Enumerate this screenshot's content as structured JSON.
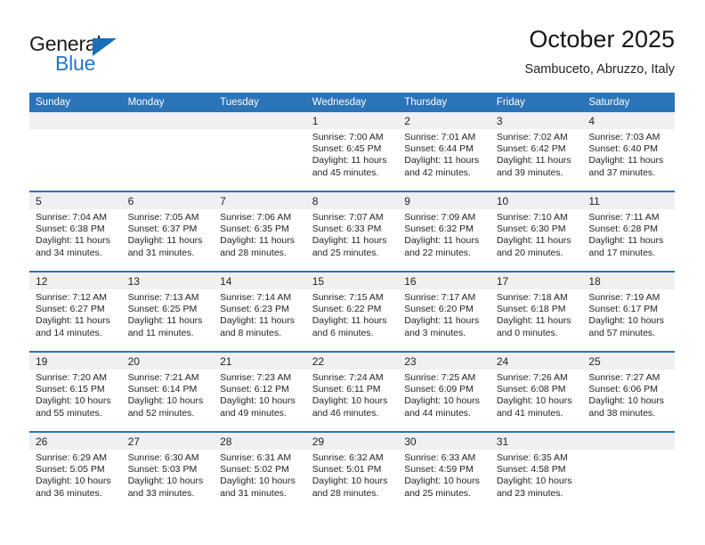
{
  "logo": {
    "word_top": "General",
    "word_bottom": "Blue",
    "triangle_color": "#1a6fb5",
    "blue_color": "#2277c8"
  },
  "header": {
    "title": "October 2025",
    "subtitle": "Sambuceto, Abruzzo, Italy"
  },
  "theme": {
    "header_blue": "#2b74b8",
    "daynum_gray": "#f0f0f0"
  },
  "weekday_headers": [
    "Sunday",
    "Monday",
    "Tuesday",
    "Wednesday",
    "Thursday",
    "Friday",
    "Saturday"
  ],
  "weeks": [
    [
      {
        "day": "",
        "empty": true
      },
      {
        "day": "",
        "empty": true
      },
      {
        "day": "",
        "empty": true
      },
      {
        "day": "1",
        "sunrise": "Sunrise: 7:00 AM",
        "sunset": "Sunset: 6:45 PM",
        "daylight1": "Daylight: 11 hours",
        "daylight2": "and 45 minutes."
      },
      {
        "day": "2",
        "sunrise": "Sunrise: 7:01 AM",
        "sunset": "Sunset: 6:44 PM",
        "daylight1": "Daylight: 11 hours",
        "daylight2": "and 42 minutes."
      },
      {
        "day": "3",
        "sunrise": "Sunrise: 7:02 AM",
        "sunset": "Sunset: 6:42 PM",
        "daylight1": "Daylight: 11 hours",
        "daylight2": "and 39 minutes."
      },
      {
        "day": "4",
        "sunrise": "Sunrise: 7:03 AM",
        "sunset": "Sunset: 6:40 PM",
        "daylight1": "Daylight: 11 hours",
        "daylight2": "and 37 minutes."
      }
    ],
    [
      {
        "day": "5",
        "sunrise": "Sunrise: 7:04 AM",
        "sunset": "Sunset: 6:38 PM",
        "daylight1": "Daylight: 11 hours",
        "daylight2": "and 34 minutes."
      },
      {
        "day": "6",
        "sunrise": "Sunrise: 7:05 AM",
        "sunset": "Sunset: 6:37 PM",
        "daylight1": "Daylight: 11 hours",
        "daylight2": "and 31 minutes."
      },
      {
        "day": "7",
        "sunrise": "Sunrise: 7:06 AM",
        "sunset": "Sunset: 6:35 PM",
        "daylight1": "Daylight: 11 hours",
        "daylight2": "and 28 minutes."
      },
      {
        "day": "8",
        "sunrise": "Sunrise: 7:07 AM",
        "sunset": "Sunset: 6:33 PM",
        "daylight1": "Daylight: 11 hours",
        "daylight2": "and 25 minutes."
      },
      {
        "day": "9",
        "sunrise": "Sunrise: 7:09 AM",
        "sunset": "Sunset: 6:32 PM",
        "daylight1": "Daylight: 11 hours",
        "daylight2": "and 22 minutes."
      },
      {
        "day": "10",
        "sunrise": "Sunrise: 7:10 AM",
        "sunset": "Sunset: 6:30 PM",
        "daylight1": "Daylight: 11 hours",
        "daylight2": "and 20 minutes."
      },
      {
        "day": "11",
        "sunrise": "Sunrise: 7:11 AM",
        "sunset": "Sunset: 6:28 PM",
        "daylight1": "Daylight: 11 hours",
        "daylight2": "and 17 minutes."
      }
    ],
    [
      {
        "day": "12",
        "sunrise": "Sunrise: 7:12 AM",
        "sunset": "Sunset: 6:27 PM",
        "daylight1": "Daylight: 11 hours",
        "daylight2": "and 14 minutes."
      },
      {
        "day": "13",
        "sunrise": "Sunrise: 7:13 AM",
        "sunset": "Sunset: 6:25 PM",
        "daylight1": "Daylight: 11 hours",
        "daylight2": "and 11 minutes."
      },
      {
        "day": "14",
        "sunrise": "Sunrise: 7:14 AM",
        "sunset": "Sunset: 6:23 PM",
        "daylight1": "Daylight: 11 hours",
        "daylight2": "and 8 minutes."
      },
      {
        "day": "15",
        "sunrise": "Sunrise: 7:15 AM",
        "sunset": "Sunset: 6:22 PM",
        "daylight1": "Daylight: 11 hours",
        "daylight2": "and 6 minutes."
      },
      {
        "day": "16",
        "sunrise": "Sunrise: 7:17 AM",
        "sunset": "Sunset: 6:20 PM",
        "daylight1": "Daylight: 11 hours",
        "daylight2": "and 3 minutes."
      },
      {
        "day": "17",
        "sunrise": "Sunrise: 7:18 AM",
        "sunset": "Sunset: 6:18 PM",
        "daylight1": "Daylight: 11 hours",
        "daylight2": "and 0 minutes."
      },
      {
        "day": "18",
        "sunrise": "Sunrise: 7:19 AM",
        "sunset": "Sunset: 6:17 PM",
        "daylight1": "Daylight: 10 hours",
        "daylight2": "and 57 minutes."
      }
    ],
    [
      {
        "day": "19",
        "sunrise": "Sunrise: 7:20 AM",
        "sunset": "Sunset: 6:15 PM",
        "daylight1": "Daylight: 10 hours",
        "daylight2": "and 55 minutes."
      },
      {
        "day": "20",
        "sunrise": "Sunrise: 7:21 AM",
        "sunset": "Sunset: 6:14 PM",
        "daylight1": "Daylight: 10 hours",
        "daylight2": "and 52 minutes."
      },
      {
        "day": "21",
        "sunrise": "Sunrise: 7:23 AM",
        "sunset": "Sunset: 6:12 PM",
        "daylight1": "Daylight: 10 hours",
        "daylight2": "and 49 minutes."
      },
      {
        "day": "22",
        "sunrise": "Sunrise: 7:24 AM",
        "sunset": "Sunset: 6:11 PM",
        "daylight1": "Daylight: 10 hours",
        "daylight2": "and 46 minutes."
      },
      {
        "day": "23",
        "sunrise": "Sunrise: 7:25 AM",
        "sunset": "Sunset: 6:09 PM",
        "daylight1": "Daylight: 10 hours",
        "daylight2": "and 44 minutes."
      },
      {
        "day": "24",
        "sunrise": "Sunrise: 7:26 AM",
        "sunset": "Sunset: 6:08 PM",
        "daylight1": "Daylight: 10 hours",
        "daylight2": "and 41 minutes."
      },
      {
        "day": "25",
        "sunrise": "Sunrise: 7:27 AM",
        "sunset": "Sunset: 6:06 PM",
        "daylight1": "Daylight: 10 hours",
        "daylight2": "and 38 minutes."
      }
    ],
    [
      {
        "day": "26",
        "sunrise": "Sunrise: 6:29 AM",
        "sunset": "Sunset: 5:05 PM",
        "daylight1": "Daylight: 10 hours",
        "daylight2": "and 36 minutes."
      },
      {
        "day": "27",
        "sunrise": "Sunrise: 6:30 AM",
        "sunset": "Sunset: 5:03 PM",
        "daylight1": "Daylight: 10 hours",
        "daylight2": "and 33 minutes."
      },
      {
        "day": "28",
        "sunrise": "Sunrise: 6:31 AM",
        "sunset": "Sunset: 5:02 PM",
        "daylight1": "Daylight: 10 hours",
        "daylight2": "and 31 minutes."
      },
      {
        "day": "29",
        "sunrise": "Sunrise: 6:32 AM",
        "sunset": "Sunset: 5:01 PM",
        "daylight1": "Daylight: 10 hours",
        "daylight2": "and 28 minutes."
      },
      {
        "day": "30",
        "sunrise": "Sunrise: 6:33 AM",
        "sunset": "Sunset: 4:59 PM",
        "daylight1": "Daylight: 10 hours",
        "daylight2": "and 25 minutes."
      },
      {
        "day": "31",
        "sunrise": "Sunrise: 6:35 AM",
        "sunset": "Sunset: 4:58 PM",
        "daylight1": "Daylight: 10 hours",
        "daylight2": "and 23 minutes."
      },
      {
        "day": "",
        "empty": true
      }
    ]
  ]
}
